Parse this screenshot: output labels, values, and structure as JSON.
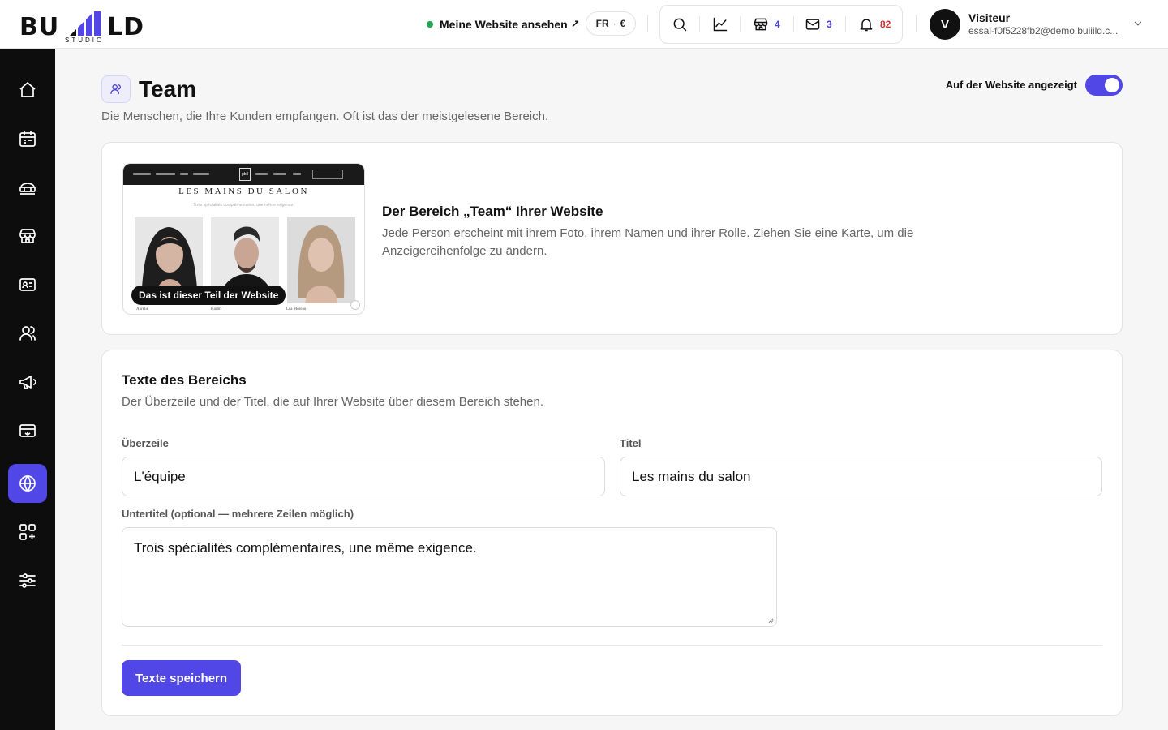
{
  "brand": {
    "logo_text_left": "BU",
    "logo_text_right": "LD",
    "logo_sub": "STUDIO",
    "accent": "#5147e6"
  },
  "header": {
    "view_site_label": "Meine Website ansehen",
    "view_site_arrow": "↗",
    "status_color": "#22a559",
    "lang": "FR",
    "currency": "€",
    "tools": [
      {
        "icon": "search-icon",
        "count": ""
      },
      {
        "icon": "chart-line-icon",
        "count": ""
      },
      {
        "icon": "store-icon",
        "count": "4",
        "count_color": "#4a40d8"
      },
      {
        "icon": "mail-icon",
        "count": "3",
        "count_color": "#4a40d8"
      },
      {
        "icon": "bell-icon",
        "count": "82",
        "count_color": "#d32f2f"
      }
    ],
    "user": {
      "initial": "V",
      "name": "Visiteur",
      "email": "essai-f0f5228fb2@demo.buiiild.c..."
    }
  },
  "sidebar": {
    "items": [
      {
        "icon": "home-icon",
        "active": false
      },
      {
        "icon": "calendar-icon",
        "active": false
      },
      {
        "icon": "services-icon",
        "active": false
      },
      {
        "icon": "store-icon",
        "active": false
      },
      {
        "icon": "contact-card-icon",
        "active": false
      },
      {
        "icon": "users-icon",
        "active": false
      },
      {
        "icon": "megaphone-icon",
        "active": false
      },
      {
        "icon": "payment-card-icon",
        "active": false
      },
      {
        "icon": "globe-icon",
        "active": true
      },
      {
        "icon": "apps-add-icon",
        "active": false
      },
      {
        "icon": "sliders-icon",
        "active": false
      }
    ]
  },
  "page": {
    "title": "Team",
    "description": "Die Menschen, die Ihre Kunden empfangen. Oft ist das der meistgelesene Bereich.",
    "visibility_label": "Auf der Website angezeigt",
    "visibility_on": true
  },
  "preview_card": {
    "preview": {
      "heading": "LES MAINS DU SALON",
      "subheading": "Trois spécialités complémentaires, une même exigence.",
      "badge": "Das ist dieser Teil der Website",
      "brand_mark": "pbll",
      "members": [
        "Aurélie",
        "Karim",
        "Léa Moreau"
      ]
    },
    "title": "Der Bereich „Team“ Ihrer Website",
    "description": "Jede Person erscheint mit ihrem Foto, ihrem Namen und ihrer Rolle. Ziehen Sie eine Karte, um die Anzeigereihenfolge zu ändern."
  },
  "texts_card": {
    "title": "Texte des Bereichs",
    "description": "Der Überzeile und der Titel, die auf Ihrer Website über diesem Bereich stehen.",
    "overline_label": "Überzeile",
    "overline_value": "L'équipe",
    "title_label": "Titel",
    "title_value": "Les mains du salon",
    "subtitle_label": "Untertitel (optional — mehrere Zeilen möglich)",
    "subtitle_value": "Trois spécialités complémentaires, une même exigence.",
    "save_label": "Texte speichern"
  }
}
